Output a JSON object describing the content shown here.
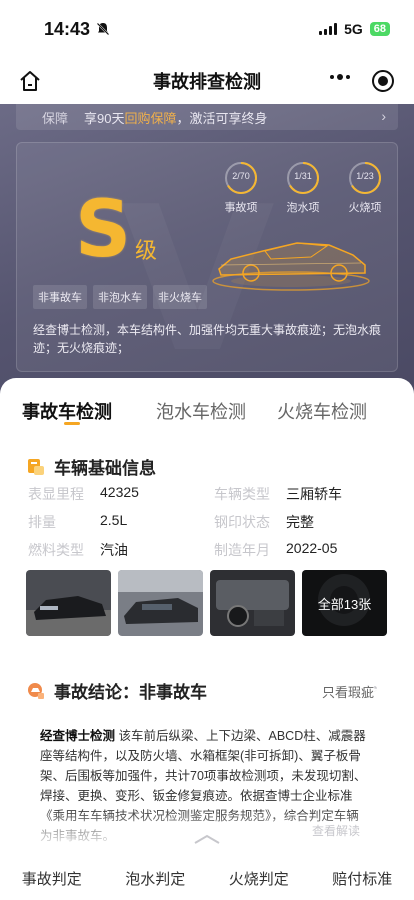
{
  "status_bar": {
    "time": "14:43",
    "network": "5G",
    "battery": "68"
  },
  "nav": {
    "title": "事故排查检测"
  },
  "guarantee": {
    "tag": "保障",
    "text_prefix": "享90天",
    "text_highlight": "回购保障",
    "text_suffix": "，激活可享终身"
  },
  "grade": {
    "letter": "S",
    "suffix": "级"
  },
  "rings": [
    {
      "value": "2/70",
      "label": "事故项"
    },
    {
      "value": "1/31",
      "label": "泡水项"
    },
    {
      "value": "1/23",
      "label": "火烧项"
    }
  ],
  "badges": [
    "非事故车",
    "非泡水车",
    "非火烧车"
  ],
  "summary": "经查博士检测，本车结构件、加强件均无重大事故痕迹；无泡水痕迹；无火烧痕迹；",
  "tabs": [
    "事故车检测",
    "泡水车检测",
    "火烧车检测"
  ],
  "basic_info": {
    "title": "车辆基础信息",
    "rows": [
      {
        "l1": "表显里程",
        "v1": "42325",
        "l2": "车辆类型",
        "v2": "三厢轿车"
      },
      {
        "l1": "排量",
        "v1": "2.5L",
        "l2": "钢印状态",
        "v2": "完整"
      },
      {
        "l1": "燃料类型",
        "v1": "汽油",
        "l2": "制造年月",
        "v2": "2022-05"
      }
    ]
  },
  "photos": {
    "more_label": "全部13张"
  },
  "conclusion": {
    "title": "事故结论：非事故车",
    "link": "只看瑕疵",
    "body_bold": "经查博士检测",
    "body": "该车前后纵梁、上下边梁、ABCD柱、减震器座等结构件，以及防火墙、水箱框架(非可拆卸)、翼子板骨架、后围板等加强件，共计70项事故检测项，未发现切割、焊接、更换、变形、钣金修复痕迹。依据查博士企业标准《乘用车车辆技术状况检测鉴定服务规范》，综合判定车辆为非事故车。",
    "view_more": "查看解读"
  },
  "bottom_nav": [
    "事故判定",
    "泡水判定",
    "火烧判定",
    "赔付标准"
  ]
}
